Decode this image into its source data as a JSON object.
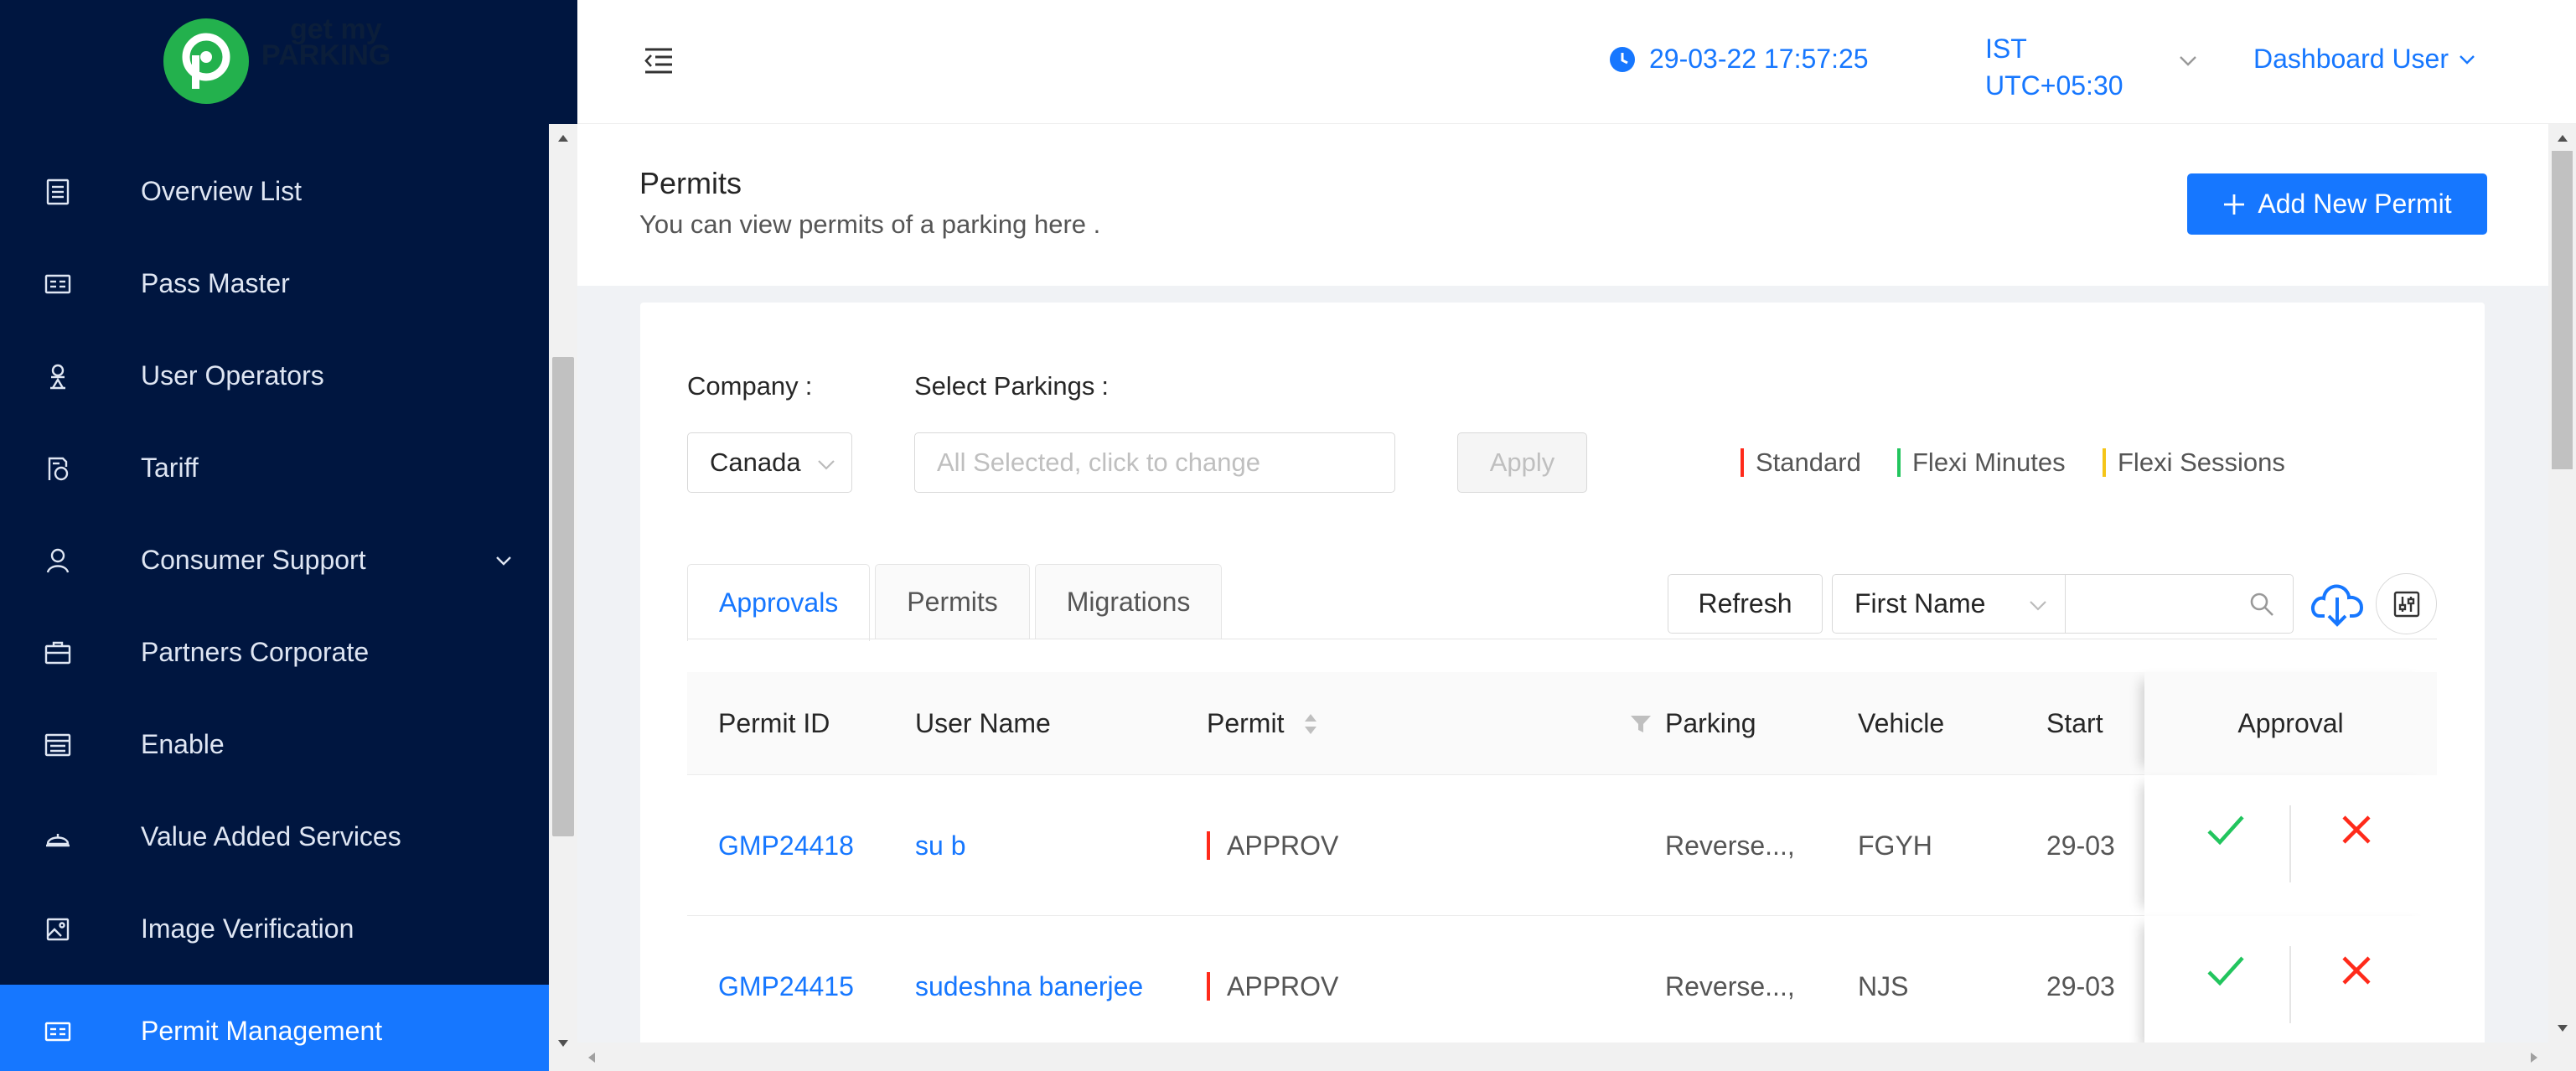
{
  "logo": {
    "text_line1": "get my",
    "text_line2": "PARKING"
  },
  "sidebar": {
    "items": [
      {
        "label": "Overview List",
        "icon": "list-icon"
      },
      {
        "label": "Pass Master",
        "icon": "id-card-icon"
      },
      {
        "label": "User Operators",
        "icon": "operator-icon"
      },
      {
        "label": "Tariff",
        "icon": "tariff-icon"
      },
      {
        "label": "Consumer Support",
        "icon": "user-icon"
      },
      {
        "label": "Partners Corporate",
        "icon": "briefcase-icon"
      },
      {
        "label": "Enable",
        "icon": "enable-icon"
      },
      {
        "label": "Value Added Services",
        "icon": "service-icon"
      },
      {
        "label": "Image Verification",
        "icon": "image-icon"
      },
      {
        "label": "Permit Management",
        "icon": "permit-icon"
      }
    ]
  },
  "header": {
    "datetime": "29-03-22 17:57:25",
    "tz_name": "IST",
    "tz_offset": "UTC+05:30",
    "user": "Dashboard User"
  },
  "page": {
    "title": "Permits",
    "subtitle": "You can view permits of a parking here .",
    "add_button": "Add New Permit"
  },
  "filters": {
    "company_label": "Company",
    "company_value": "Canada",
    "parkings_label": "Select Parkings",
    "parkings_placeholder": "All Selected, click to change",
    "apply": "Apply",
    "colon": ":"
  },
  "legend": [
    {
      "label": "Standard",
      "color": "#ff2a1a"
    },
    {
      "label": "Flexi Minutes",
      "color": "#22c55e"
    },
    {
      "label": "Flexi Sessions",
      "color": "#f5c518"
    }
  ],
  "tabs": [
    "Approvals",
    "Permits",
    "Migrations"
  ],
  "toolbar": {
    "refresh": "Refresh",
    "search_field": "First Name"
  },
  "table": {
    "columns": [
      "Permit ID",
      "User Name",
      "Permit",
      "Parking",
      "Vehicle",
      "Start",
      "Approval"
    ],
    "rows": [
      {
        "permit_id": "GMP24418",
        "user": "su b",
        "permit": "APPROV",
        "parking": "Reverse...,",
        "vehicle": "FGYH",
        "start": "29-03"
      },
      {
        "permit_id": "GMP24415",
        "user": "sudeshna banerjee",
        "permit": "APPROV",
        "parking": "Reverse...,",
        "vehicle": "NJS",
        "start": "29-03"
      }
    ]
  },
  "colors": {
    "sidebar_bg": "#001640",
    "accent": "#1677ff",
    "approve": "#22c55e",
    "reject": "#ff2a1a"
  }
}
